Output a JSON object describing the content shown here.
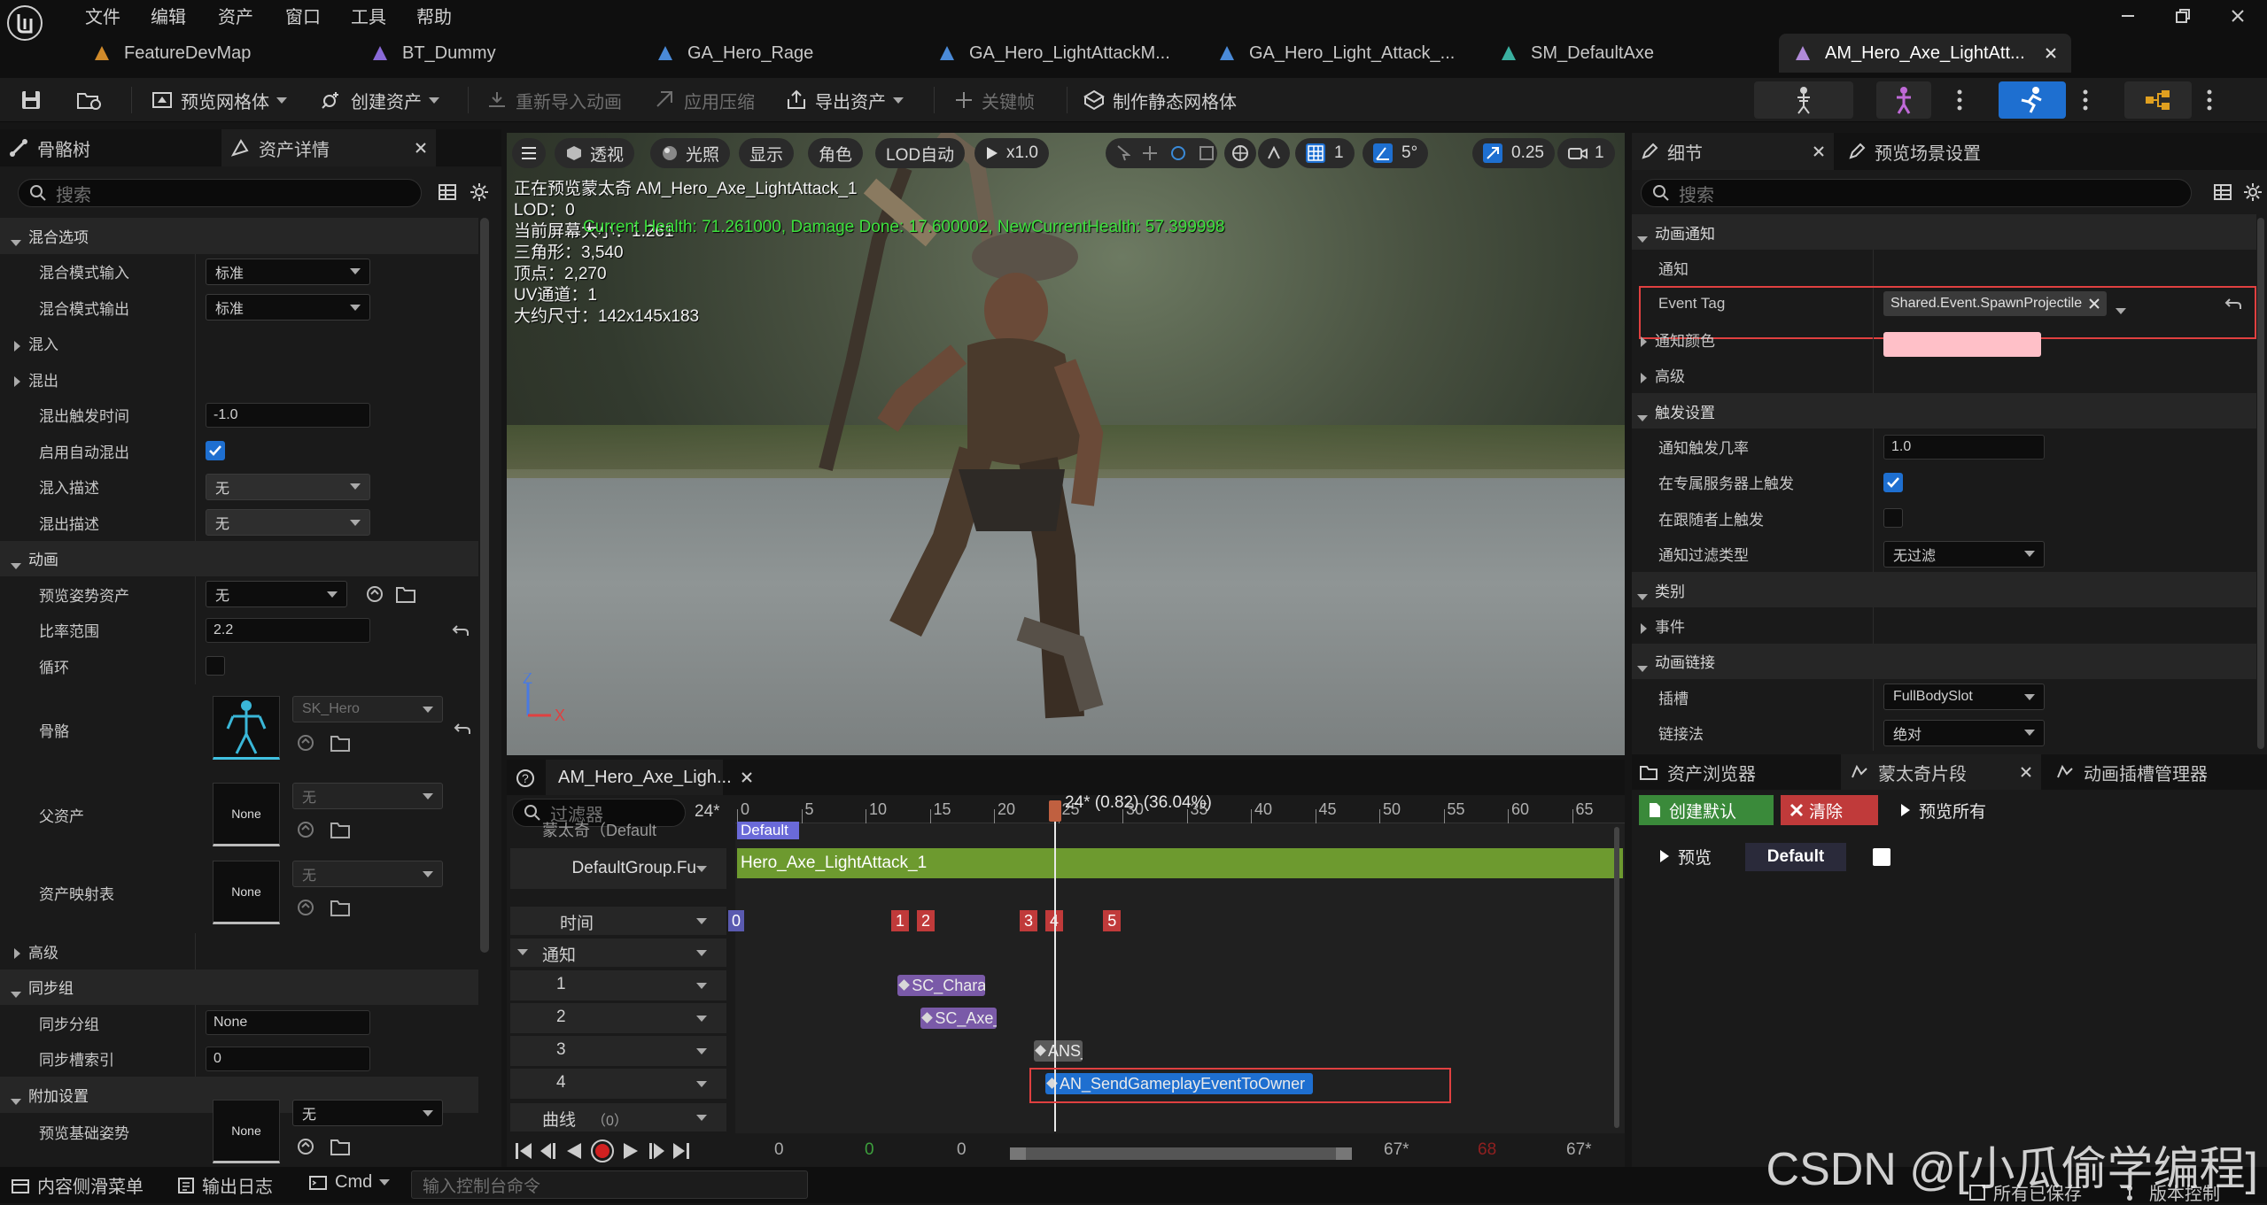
{
  "menu": [
    "文件",
    "编辑",
    "资产",
    "窗口",
    "工具",
    "帮助"
  ],
  "tabs": [
    {
      "label": "FeatureDevMap",
      "icon": "map-icon",
      "color": "#d08a2a"
    },
    {
      "label": "BT_Dummy",
      "icon": "behavior-tree-icon",
      "color": "#8a6ad8"
    },
    {
      "label": "GA_Hero_Rage",
      "icon": "blueprint-icon",
      "color": "#4a8ad8"
    },
    {
      "label": "GA_Hero_LightAttackM...",
      "icon": "blueprint-icon",
      "color": "#4a8ad8"
    },
    {
      "label": "GA_Hero_Light_Attack_...",
      "icon": "blueprint-icon",
      "color": "#4a8ad8"
    },
    {
      "label": "SM_DefaultAxe",
      "icon": "static-mesh-icon",
      "color": "#3ab0a0"
    },
    {
      "label": "AM_Hero_Axe_LightAtt...",
      "icon": "anim-montage-icon",
      "color": "#b08ad8",
      "active": true
    }
  ],
  "toolbar": {
    "preview_mesh": "预览网格体",
    "create_asset": "创建资产",
    "reimport": "重新导入动画",
    "apply_compression": "应用压缩",
    "export_asset": "导出资产",
    "keyframe": "关键帧",
    "make_static_mesh": "制作静态网格体"
  },
  "left": {
    "tabs": [
      "骨骼树",
      "资产详情"
    ],
    "search_placeholder": "搜索",
    "rows": [
      {
        "type": "cat",
        "label": "混合选项"
      },
      {
        "type": "combo",
        "label": "混合模式输入",
        "value": "标准"
      },
      {
        "type": "combo",
        "label": "混合模式输出",
        "value": "标准"
      },
      {
        "type": "sub",
        "label": "混入"
      },
      {
        "type": "sub",
        "label": "混出"
      },
      {
        "type": "field",
        "label": "混出触发时间",
        "value": "-1.0"
      },
      {
        "type": "check",
        "label": "启用自动混出",
        "checked": true
      },
      {
        "type": "combo-gray",
        "label": "混入描述",
        "value": "无"
      },
      {
        "type": "combo-gray",
        "label": "混出描述",
        "value": "无"
      },
      {
        "type": "cat",
        "label": "动画"
      },
      {
        "type": "asset-combo",
        "label": "预览姿势资产",
        "value": "无"
      },
      {
        "type": "field-reset",
        "label": "比率范围",
        "value": "2.2"
      },
      {
        "type": "check",
        "label": "循环",
        "checked": false
      }
    ],
    "skeleton": {
      "label": "骨骼",
      "value": "SK_Hero"
    },
    "parent_asset": {
      "label": "父资产",
      "thumb": "None",
      "value": "无"
    },
    "asset_mapping": {
      "label": "资产映射表",
      "thumb": "None",
      "value": "无"
    },
    "rows2": [
      {
        "type": "sub",
        "label": "高级"
      },
      {
        "type": "cat",
        "label": "同步组"
      },
      {
        "type": "field",
        "label": "同步分组",
        "value": "None"
      },
      {
        "type": "field",
        "label": "同步槽索引",
        "value": "0"
      },
      {
        "type": "cat",
        "label": "附加设置"
      }
    ],
    "preview_base_pose": {
      "label": "预览基础姿势",
      "thumb": "None",
      "value": "无"
    }
  },
  "viewport": {
    "buttons": [
      "透视",
      "光照",
      "显示",
      "角色",
      "LOD自动",
      "x1.0"
    ],
    "right_values": [
      "1",
      "5°",
      "0.25",
      "1"
    ],
    "overlay": [
      "正在预览蒙太奇 AM_Hero_Axe_LightAttack_1",
      "LOD：0",
      "当前屏幕大小：1.261",
      "三角形：3,540",
      "顶点：2,270",
      "UV通道：1",
      "大约尺寸：142x145x183"
    ],
    "debug_text": "Current Health: 71.261000, Damage Done: 17.600002, NewCurrentHealth: 57.399998"
  },
  "montage": {
    "tab_label": "AM_Hero_Axe_Ligh...",
    "filter_placeholder": "过滤器",
    "frame_field": "24*",
    "playhead_label": "24* (0.82) (36.04%)",
    "ruler_ticks": [
      "0",
      "5",
      "10",
      "15",
      "20",
      "25",
      "30",
      "35",
      "40",
      "45",
      "50",
      "55",
      "60",
      "65"
    ],
    "montage_row_label": "蒙太奇（Default",
    "section_default": "Default",
    "slot_label": "DefaultGroup.Fu",
    "slot_anim": "Hero_Axe_LightAttack_1",
    "timing_label": "时间",
    "timing_marks": [
      "0",
      "1",
      "2",
      "3",
      "4",
      "5"
    ],
    "notify_label": "通知",
    "tracks": [
      "1",
      "2",
      "3",
      "4"
    ],
    "notifies": [
      {
        "track": 1,
        "label": "SC_Character_Effor",
        "color": "#7a5aa8"
      },
      {
        "track": 2,
        "label": "SC_Axe_Swing",
        "color": "#7a5aa8"
      },
      {
        "track": 3,
        "label": "ANS_To",
        "color": "#5a5a5a"
      },
      {
        "track": 4,
        "label": "AN_SendGameplayEventToOwner",
        "color": "#1e6fd0"
      }
    ],
    "curves_label": "曲线",
    "curves_count": "（0）",
    "transport": {
      "start": "0",
      "green": "0",
      "current": "0",
      "end": "67*",
      "red": "68",
      "end2": "67*"
    }
  },
  "details": {
    "tabs": [
      "细节",
      "预览场景设置"
    ],
    "search_placeholder": "搜索",
    "rows": [
      {
        "type": "cat",
        "label": "动画通知"
      },
      {
        "type": "plain",
        "label": "通知"
      },
      {
        "type": "tag",
        "label": "Event Tag",
        "value": "Shared.Event.SpawnProjectile"
      },
      {
        "type": "sub",
        "label": "通知颜色"
      },
      {
        "type": "sub",
        "label": "高级"
      },
      {
        "type": "cat",
        "label": "触发设置"
      },
      {
        "type": "field",
        "label": "通知触发几率",
        "value": "1.0"
      },
      {
        "type": "check",
        "label": "在专属服务器上触发",
        "checked": true
      },
      {
        "type": "check",
        "label": "在跟随者上触发",
        "checked": false
      },
      {
        "type": "combo",
        "label": "通知过滤类型",
        "value": "无过滤"
      },
      {
        "type": "cat",
        "label": "类别"
      },
      {
        "type": "sub",
        "label": "事件"
      },
      {
        "type": "cat",
        "label": "动画链接"
      },
      {
        "type": "combo",
        "label": "插槽",
        "value": "FullBodySlot"
      },
      {
        "type": "combo",
        "label": "链接法",
        "value": "绝对"
      }
    ]
  },
  "mpanel": {
    "tabs": [
      "资产浏览器",
      "蒙太奇片段",
      "动画插槽管理器"
    ],
    "create_default": "创建默认",
    "clear": "清除",
    "preview_all": "预览所有",
    "preview": "预览",
    "section_name": "Default"
  },
  "bottom": {
    "content_drawer": "内容侧滑菜单",
    "output_log": "输出日志",
    "cmd": "Cmd",
    "console_placeholder": "输入控制台命令",
    "all_saved": "所有已保存",
    "version_control": "版本控制"
  },
  "watermark": "CSDN @[小瓜偷学编程]",
  "colors": {
    "accent": "#1e6fd0",
    "slot_green": "#6d9a2f",
    "timing_red": "#c03a3a",
    "create_btn": "#3a8a3a",
    "clear_btn": "#c03a3a",
    "highlight_box": "#e04040"
  }
}
